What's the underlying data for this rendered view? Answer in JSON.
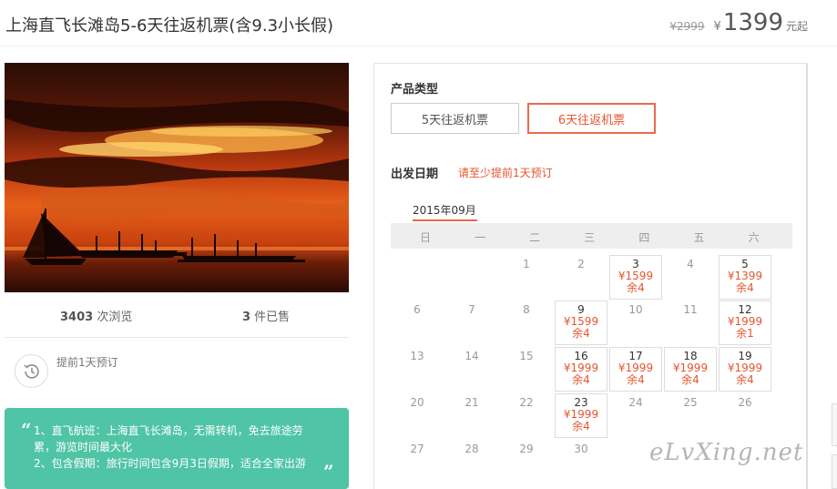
{
  "header": {
    "title": "上海直飞长滩岛5-6天往返机票(含9.3小长假)",
    "old_price": "¥2999",
    "currency": "¥",
    "price": "1399",
    "price_unit": "元起"
  },
  "stats": {
    "views_count": "3403",
    "views_label": " 次浏览",
    "sold_count": "3",
    "sold_label": " 件已售"
  },
  "advance": {
    "text": "提前1天预订",
    "icon": "clock-history-icon"
  },
  "note": {
    "lines": [
      "1、直飞航班：上海直飞长滩岛，无需转机，免去旅途劳累，游览时间最大化",
      "2、包含假期：旅行时间包含9月3日假期，适合全家出游"
    ]
  },
  "booking": {
    "type_label": "产品类型",
    "options": [
      "5天往返机票",
      "6天往返机票"
    ],
    "selected_option": "6天往返机票",
    "date_label": "出发日期",
    "date_hint": "请至少提前1天预订",
    "month": "2015年09月",
    "weekdays": [
      "日",
      "一",
      "二",
      "三",
      "四",
      "五",
      "六"
    ],
    "calendar": [
      {
        "day": "1"
      },
      {
        "day": "2"
      },
      {
        "day": "3",
        "price": "¥1599",
        "remain": "余4"
      },
      {
        "day": "4"
      },
      {
        "day": "5",
        "price": "¥1399",
        "remain": "余4"
      },
      {
        "day": "6"
      },
      {
        "day": "7"
      },
      {
        "day": "8"
      },
      {
        "day": "9",
        "price": "¥1599",
        "remain": "余4"
      },
      {
        "day": "10"
      },
      {
        "day": "11"
      },
      {
        "day": "12",
        "price": "¥1999",
        "remain": "余1"
      },
      {
        "day": "13"
      },
      {
        "day": "14"
      },
      {
        "day": "15"
      },
      {
        "day": "16",
        "price": "¥1999",
        "remain": "余4"
      },
      {
        "day": "17",
        "price": "¥1999",
        "remain": "余4"
      },
      {
        "day": "18",
        "price": "¥1999",
        "remain": "余4"
      },
      {
        "day": "19",
        "price": "¥1999",
        "remain": "余4"
      },
      {
        "day": "20"
      },
      {
        "day": "21"
      },
      {
        "day": "22"
      },
      {
        "day": "23",
        "price": "¥1999",
        "remain": "余4"
      },
      {
        "day": "24"
      },
      {
        "day": "25"
      },
      {
        "day": "26"
      },
      {
        "day": "27"
      },
      {
        "day": "28"
      },
      {
        "day": "29"
      },
      {
        "day": "30"
      }
    ]
  },
  "watermark": "eLvXing.net",
  "colors": {
    "accent": "#e4562f",
    "note_bg": "#4fc4a6"
  }
}
